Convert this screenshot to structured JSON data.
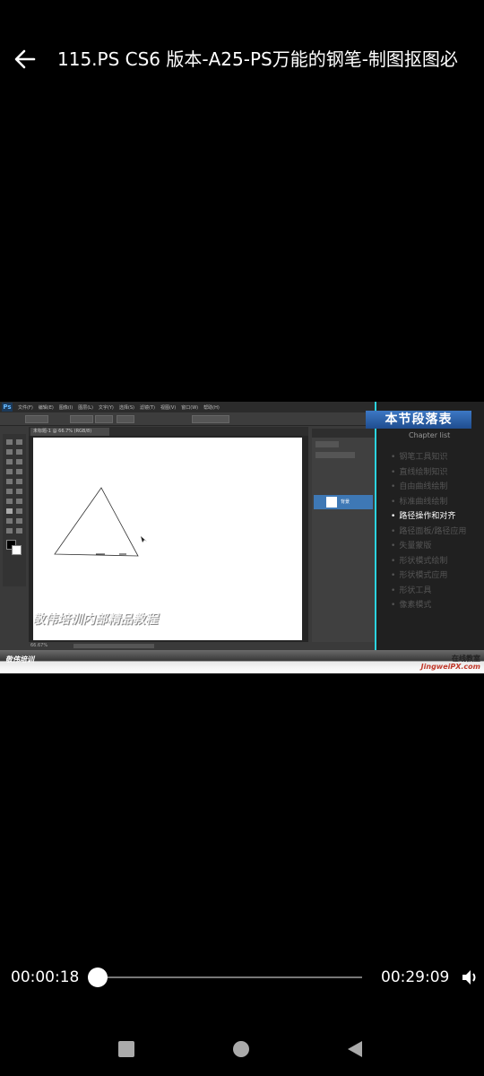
{
  "header": {
    "back_icon": "arrow-left-icon",
    "title": "115.PS CS6 版本-A25-PS万能的钢笔-制图抠图必"
  },
  "photoshop": {
    "menu_items": [
      "文件(F)",
      "编辑(E)",
      "图像(I)",
      "图层(L)",
      "文字(Y)",
      "选择(S)",
      "滤镜(T)",
      "视图(V)",
      "窗口(W)",
      "帮助(H)"
    ],
    "tab_label": "未标题-1 @ 66.7% (RGB/8)",
    "status_zoom": "66.67%",
    "layer_name": "背景"
  },
  "chapter": {
    "title": "本节段落表",
    "subtitle": "Chapter list",
    "items": [
      {
        "label": "钢笔工具知识",
        "active": false
      },
      {
        "label": "直线绘制知识",
        "active": false
      },
      {
        "label": "自由曲线绘制",
        "active": false
      },
      {
        "label": "标准曲线绘制",
        "active": false
      },
      {
        "label": "路径操作和对齐",
        "active": true
      },
      {
        "label": "路径面板/路径应用",
        "active": false
      },
      {
        "label": "失量蒙版",
        "active": false
      },
      {
        "label": "形状模式绘制",
        "active": false
      },
      {
        "label": "形状模式应用",
        "active": false
      },
      {
        "label": "形状工具",
        "active": false
      },
      {
        "label": "像素模式",
        "active": false
      }
    ]
  },
  "watermark": "敬伟培训内部精品教程",
  "brand": {
    "left": "敬伟培训",
    "right_line1": "在线教室",
    "right_line2": "JingweiPX.com"
  },
  "player": {
    "current_time": "00:00:18",
    "total_time": "00:29:09",
    "progress_fraction": 0.0103,
    "volume_icon": "speaker-icon"
  },
  "navbar": {
    "icons": [
      "square-recents-icon",
      "circle-home-icon",
      "triangle-back-icon"
    ]
  }
}
